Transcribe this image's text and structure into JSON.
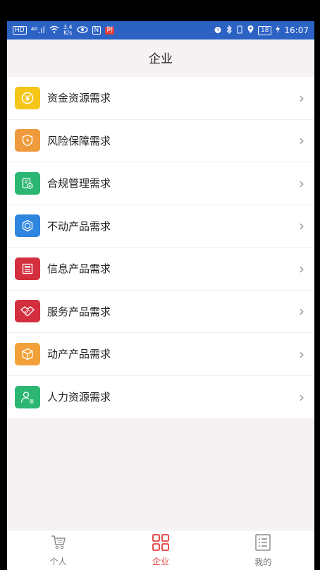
{
  "status_bar": {
    "left_hd": "HD",
    "left_signal": "⁴⁶.ıl",
    "speed_value": "3.4",
    "speed_unit": "K/s",
    "nfc": "N",
    "red_badge": "阿",
    "battery": "18",
    "time": "16:07"
  },
  "header": {
    "title": "企业"
  },
  "list": {
    "items": [
      {
        "label": "资金资源需求",
        "icon": "yen-coin-icon",
        "color": "#f5c518"
      },
      {
        "label": "风险保障需求",
        "icon": "shield-bolt-icon",
        "color": "#ef9a3c"
      },
      {
        "label": "合规管理需求",
        "icon": "document-check-icon",
        "color": "#2bb673"
      },
      {
        "label": "不动产品需求",
        "icon": "cube-icon",
        "color": "#2f86de"
      },
      {
        "label": "信息产品需求",
        "icon": "newspaper-icon",
        "color": "#d32f3f"
      },
      {
        "label": "服务产品需求",
        "icon": "handshake-icon",
        "color": "#d32f3f"
      },
      {
        "label": "动产产品需求",
        "icon": "box-icon",
        "color": "#f2a13a"
      },
      {
        "label": "人力资源需求",
        "icon": "person-list-icon",
        "color": "#2bb673"
      }
    ],
    "chevron": "›"
  },
  "tabbar": {
    "tabs": [
      {
        "label": "个人",
        "icon": "person-cart-icon",
        "active": false
      },
      {
        "label": "企业",
        "icon": "grid-apps-icon",
        "active": true
      },
      {
        "label": "我的",
        "icon": "clipboard-list-icon",
        "active": false
      }
    ]
  },
  "colors": {
    "status_bar": "#2b62c4",
    "accent": "#e23b3b",
    "background": "#f6f2f4"
  }
}
